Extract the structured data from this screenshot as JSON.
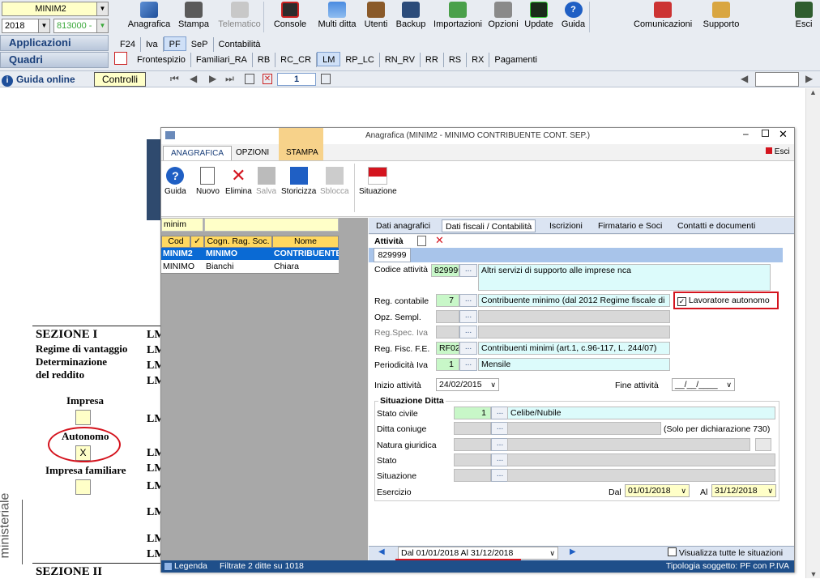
{
  "topbar": {
    "company_select": "MINIM2",
    "year_select": "2018",
    "code_select": "813000 -",
    "applicazioni_label": "Applicazioni",
    "quadri_label": "Quadri",
    "buttons": [
      "Anagrafica",
      "Stampa",
      "Telematico",
      "Console",
      "Multi ditta",
      "Utenti",
      "Backup",
      "Importazioni",
      "Opzioni",
      "Update",
      "Guida"
    ],
    "right_buttons": [
      "Comunicazioni",
      "Supporto",
      "Esci"
    ],
    "tabs": [
      "F24",
      "Iva",
      "PF",
      "SeP",
      "Contabilità"
    ],
    "quadri_tabs": [
      "Frontespizio",
      "Familiari_RA",
      "RB",
      "RC_CR",
      "LM",
      "RP_LC",
      "RN_RV",
      "RR",
      "RS",
      "RX",
      "Pagamenti"
    ],
    "guida_online": "Guida online",
    "controlli": "Controlli",
    "page_number": "1"
  },
  "form": {
    "sezione1_title": "SEZIONE I",
    "sezione1_lines": [
      "Regime di vantaggio",
      "Determinazione",
      "del reddito"
    ],
    "impresa": "Impresa",
    "autonomo": "Autonomo",
    "autonomo_value": "X",
    "impresa_familiare": "Impresa familiare",
    "lm_label": "LM",
    "sezione2_title": "SEZIONE II",
    "side_text": "ministeriale"
  },
  "dialog": {
    "title": "Anagrafica (MINIM2 - MINIMO CONTRIBUENTE CONT. SEP.)",
    "esci": "Esci",
    "ribbon_tabs": [
      "ANAGRAFICA",
      "OPZIONI",
      "STAMPA"
    ],
    "ribbon_buttons": [
      "Guida",
      "Nuovo",
      "Elimina",
      "Salva",
      "Storicizza",
      "Sblocca",
      "Situazione"
    ],
    "search_value": "minim",
    "grid_headers": [
      "Cod",
      "✓",
      "Cogn. Rag. Soc.",
      "Nome"
    ],
    "grid_rows": [
      [
        "MINIM2",
        "MINIMO",
        "CONTRIBUENTE"
      ],
      [
        "MINIMO",
        "Bianchi",
        "Chiara"
      ]
    ],
    "detail_tabs": [
      "Dati anagrafici",
      "Dati fiscali / Contabilità",
      "Iscrizioni",
      "Firmatario e Soci",
      "Contatti e documenti"
    ],
    "attivita_label": "Attività",
    "attivita_code_tab": "829999",
    "codice_attivita_label": "Codice attività",
    "codice_attivita_value": "829999",
    "codice_attivita_desc": "Altri servizi di supporto alle imprese nca",
    "reg_contabile_label": "Reg. contabile",
    "reg_contabile_value": "7",
    "reg_contabile_desc": "Contribuente minimo (dal 2012 Regime fiscale di",
    "lavoratore_autonomo": "Lavoratore autonomo",
    "opz_sempl_label": "Opz. Sempl.",
    "reg_spec_iva_label": "Reg.Spec. Iva",
    "reg_fisc_label": "Reg. Fisc. F.E.",
    "reg_fisc_value": "RF02",
    "reg_fisc_desc": "Contribuenti minimi (art.1, c.96-117, L. 244/07)",
    "periodicita_label": "Periodicità Iva",
    "periodicita_value": "1",
    "periodicita_desc": "Mensile",
    "inizio_label": "Inizio attività",
    "inizio_value": "24/02/2015",
    "fine_label": "Fine attività",
    "fine_value": "__/__/____",
    "situazione_ditta": "Situazione Ditta",
    "stato_civile_label": "Stato civile",
    "stato_civile_value": "1",
    "stato_civile_desc": "Celibe/Nubile",
    "ditta_coniuge_label": "Ditta coniuge",
    "ditta_coniuge_note": "(Solo per dichiarazione 730)",
    "natura_label": "Natura giuridica",
    "stato_label": "Stato",
    "situazione_label": "Situazione",
    "esercizio_label": "Esercizio",
    "dal_label": "Dal",
    "dal_value": "01/01/2018",
    "al_label": "Al",
    "al_value": "31/12/2018",
    "period_select": "Dal 01/01/2018 Al 31/12/2018",
    "visualizza_all": "Visualizza tutte le situazioni",
    "legenda": "Legenda",
    "filtrate": "Filtrate 2 ditte su 1018",
    "tipologia": "Tipologia soggetto: PF con P.IVA"
  }
}
